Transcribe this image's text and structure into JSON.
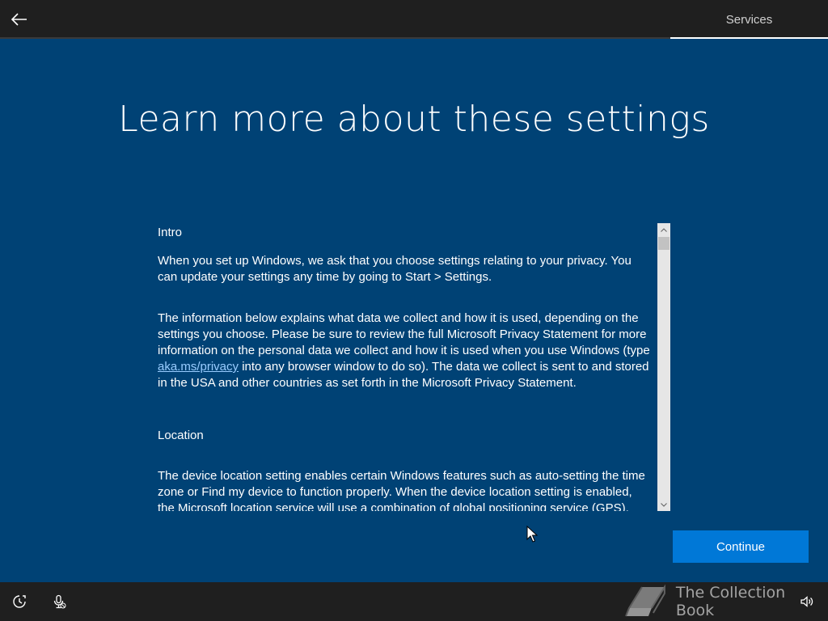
{
  "header": {
    "back_icon": "arrow-left-icon",
    "tab_label": "Services"
  },
  "title": "Learn more about these settings",
  "content": {
    "intro_heading": "Intro",
    "intro_p1": "When you set up Windows, we ask that you choose settings relating to your privacy. You can update your settings any time by going to Start > Settings.",
    "intro_p2_before_link": "The information below explains what data we collect and how it is used, depending on the settings you choose. Please be sure to review the full Microsoft Privacy Statement for more information on the personal data we collect and how it is used when you use Windows (type ",
    "intro_p2_link": "aka.ms/privacy",
    "intro_p2_after_link": " into any browser window to do so). The data we collect is sent to and stored in the USA and other countries as set forth in the Microsoft Privacy Statement.",
    "location_heading": "Location",
    "location_p1": "The device location setting enables certain Windows features such as auto-setting the time zone or Find my device to function properly. When the device location setting is enabled, the Microsoft location service will use a combination of global positioning service (GPS),"
  },
  "continue_label": "Continue",
  "footer": {
    "ease_of_access_icon": "ease-of-access-icon",
    "microphone_icon": "microphone-off-icon",
    "volume_icon": "volume-icon",
    "watermark_text": "The Collection Book"
  },
  "colors": {
    "background": "#004275",
    "accent": "#0078d7",
    "bar": "#1f1f1f"
  }
}
